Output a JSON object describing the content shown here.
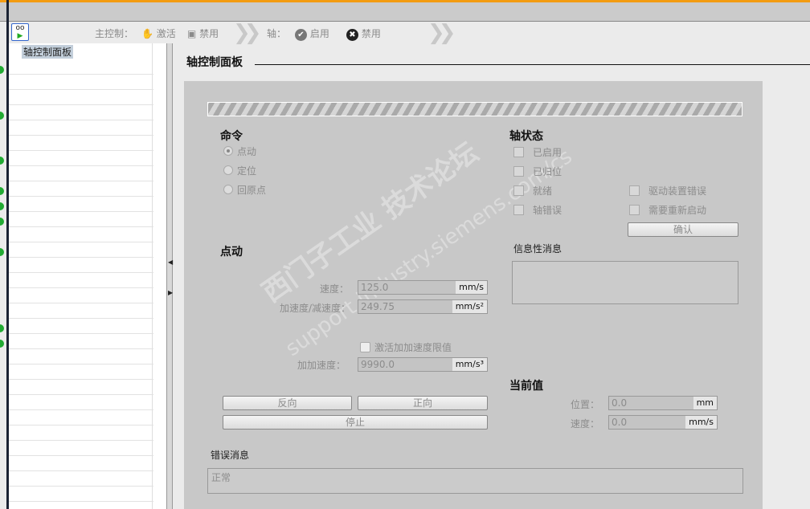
{
  "toolbar": {
    "main_control_label": "主控制：",
    "activate": "激活",
    "disable": "禁用",
    "axis_label": "轴：",
    "enable": "启用",
    "axis_disable": "禁用"
  },
  "tree": {
    "selected": "轴控制面板"
  },
  "page_title": "轴控制面板",
  "command": {
    "title": "命令",
    "options": [
      "点动",
      "定位",
      "回原点"
    ],
    "selected": 0
  },
  "axis_status": {
    "title": "轴状态",
    "left": [
      "已启用",
      "已归位",
      "就绪",
      "轴错误"
    ],
    "right": [
      "驱动装置错误",
      "需要重新启动"
    ],
    "confirm": "确认"
  },
  "info": {
    "title": "信息性消息",
    "text": ""
  },
  "jog": {
    "title": "点动",
    "speed_label": "速度：",
    "speed": "125.0",
    "speed_unit": "mm/s",
    "acc_label": "加速度/减速度：",
    "acc": "249.75",
    "acc_unit": "mm/s²",
    "jerk_enable": "激活加加速度限值",
    "jerk_label": "加加速度：",
    "jerk": "9990.0",
    "jerk_unit": "mm/s³",
    "reverse": "反向",
    "forward": "正向",
    "stop": "停止"
  },
  "current": {
    "title": "当前值",
    "pos_label": "位置：",
    "pos": "0.0",
    "pos_unit": "mm",
    "speed_label": "速度：",
    "speed": "0.0",
    "speed_unit": "mm/s"
  },
  "error": {
    "title": "错误消息",
    "text": "正常"
  },
  "watermark": {
    "line1": "西门子工业 技术论坛",
    "line2": "support.industry.siemens.com/cs"
  }
}
